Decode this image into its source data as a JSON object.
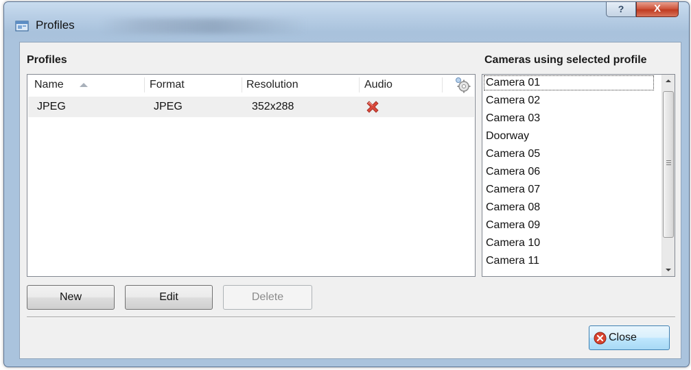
{
  "window": {
    "title": "Profiles",
    "help_glyph": "?",
    "close_glyph": "X"
  },
  "profiles_section": {
    "label": "Profiles",
    "columns": [
      "Name",
      "Format",
      "Resolution",
      "Audio"
    ],
    "rows": [
      {
        "name": "JPEG",
        "format": "JPEG",
        "resolution": "352x288",
        "audio_icon": "red-x-icon"
      }
    ]
  },
  "cameras_section": {
    "label": "Cameras using selected profile",
    "items": [
      "Camera 01",
      "Camera 02",
      "Camera 03",
      "Doorway",
      "Camera 05",
      "Camera 06",
      "Camera 07",
      "Camera 08",
      "Camera 09",
      "Camera 10",
      "Camera 11"
    ]
  },
  "buttons": {
    "new": "New",
    "edit": "Edit",
    "delete": "Delete",
    "close": "Close"
  },
  "colors": {
    "titlebar": "#b9cfe6",
    "close_button_red": "#c03b22",
    "audio_x_red": "#d9473a"
  }
}
